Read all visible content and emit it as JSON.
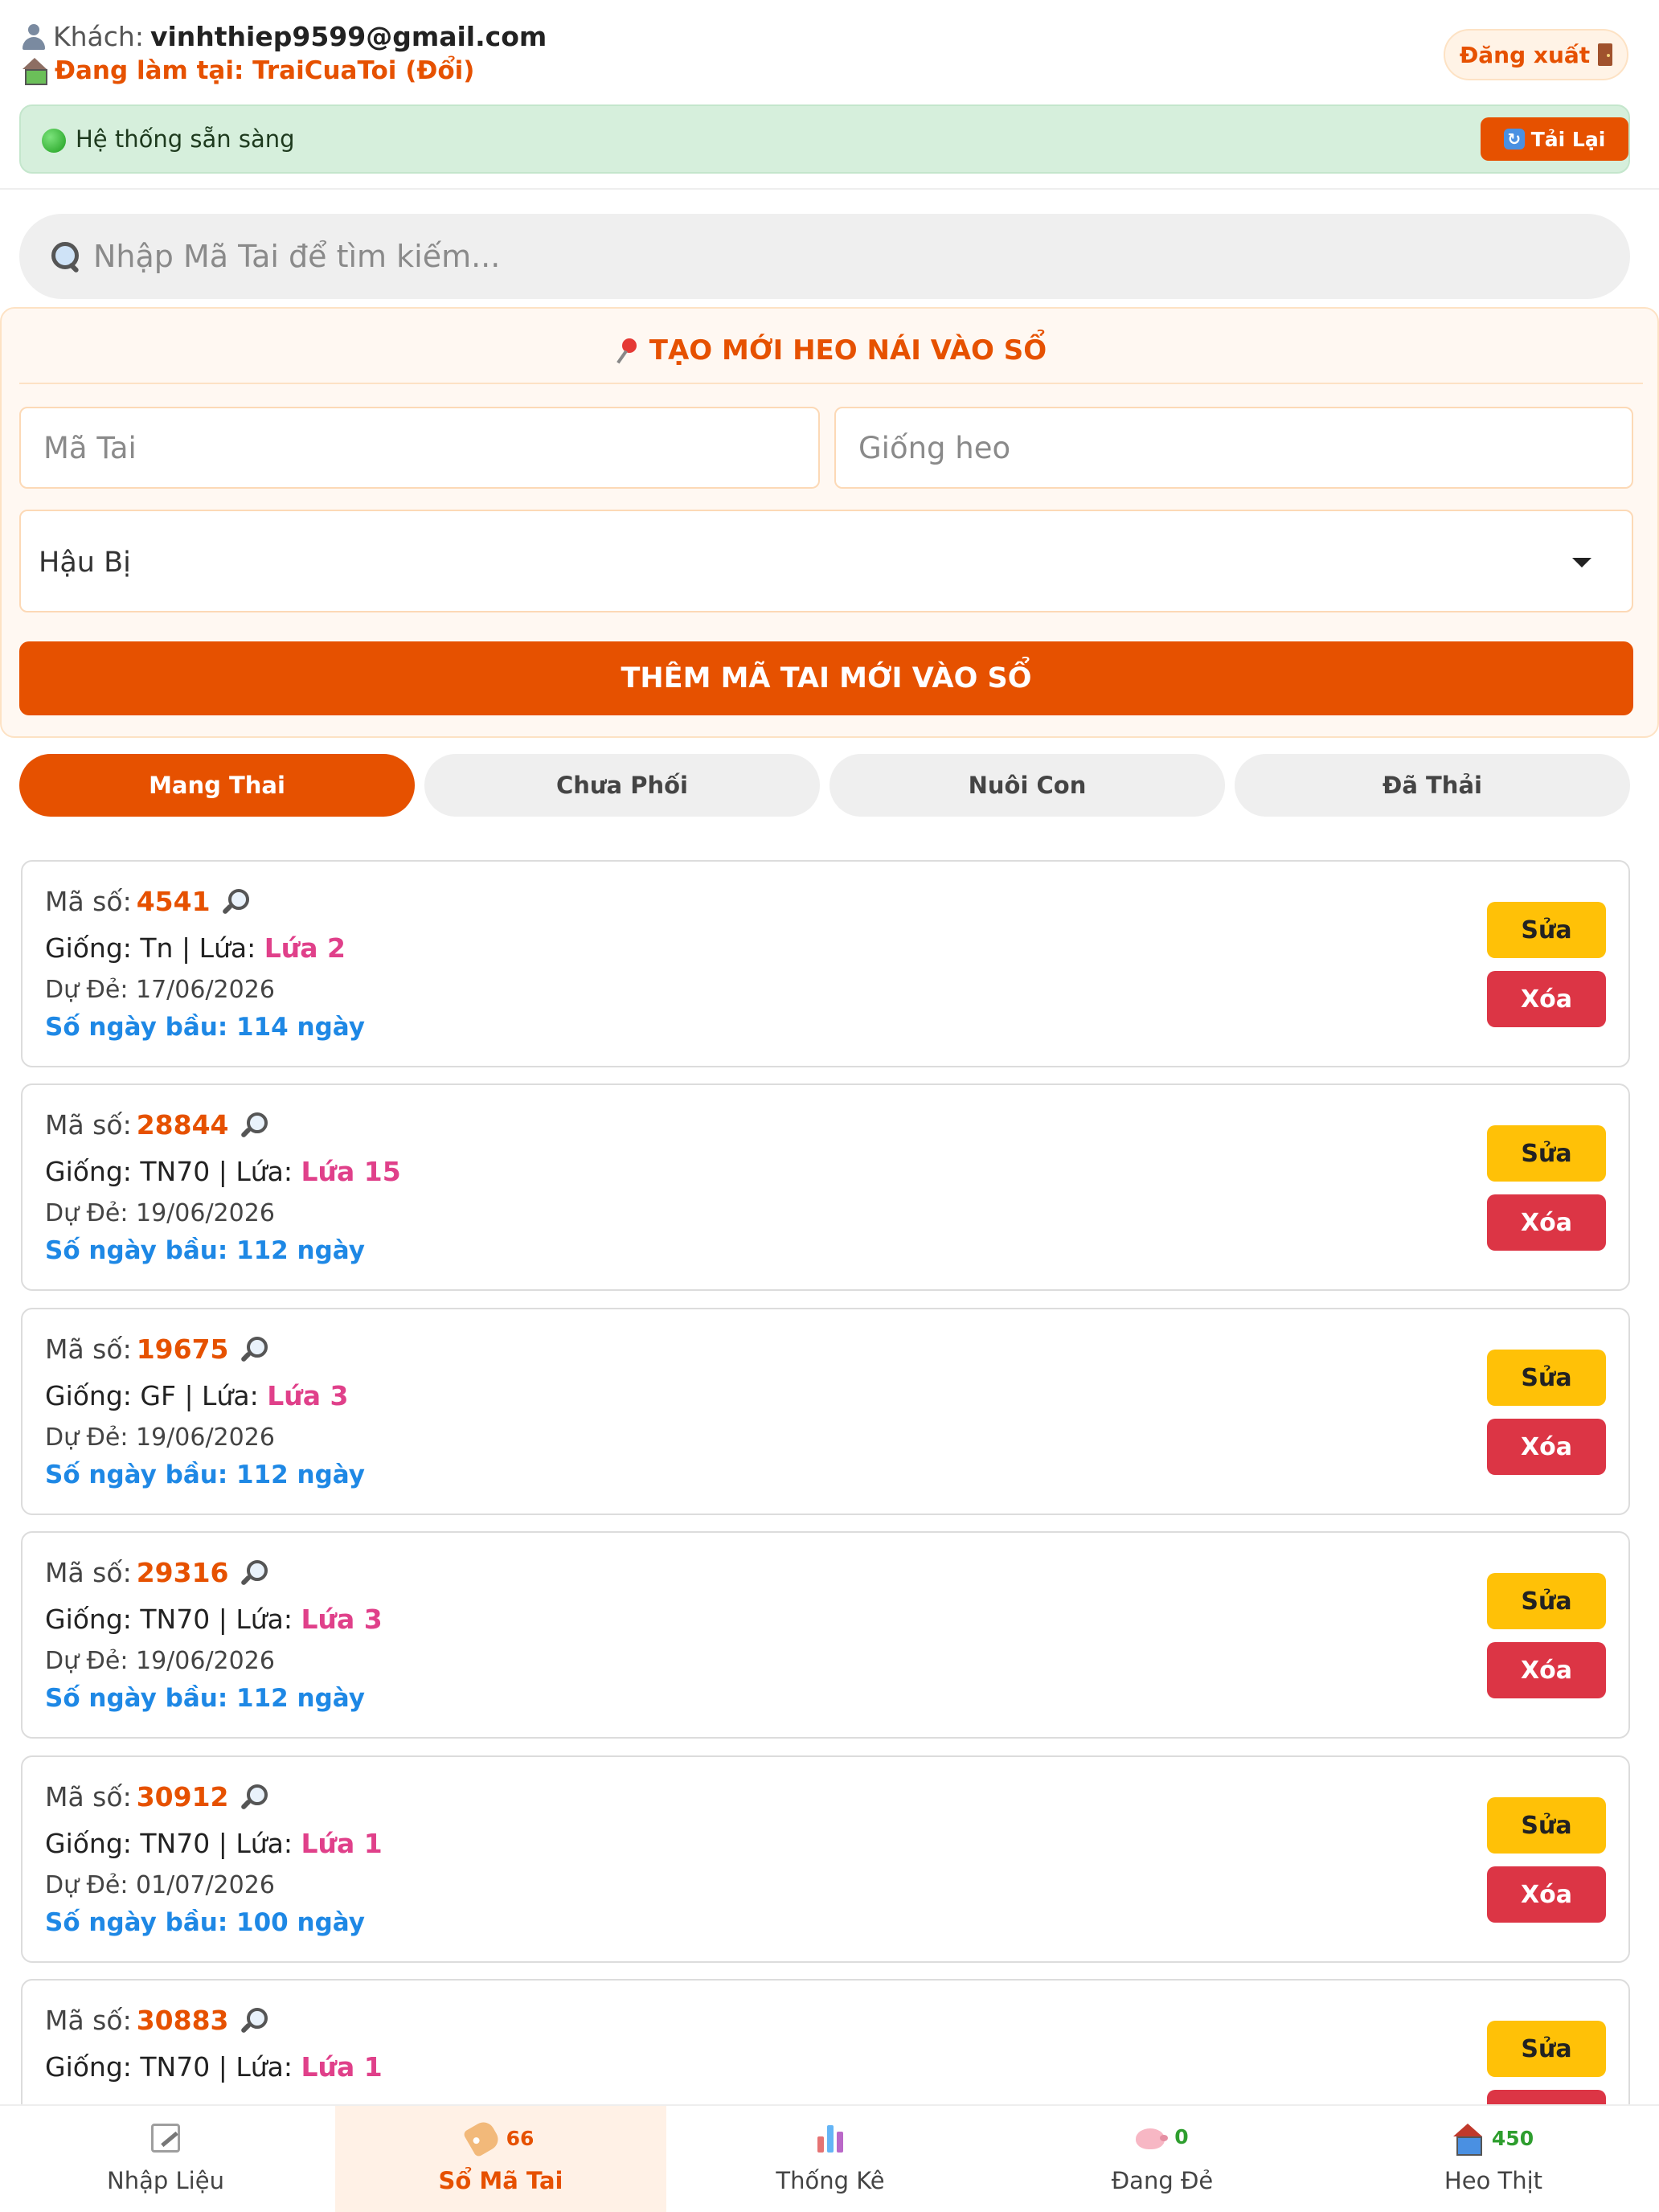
{
  "header": {
    "guest_label": "Khách:",
    "email": "vinhthiep9599@gmail.com",
    "farm_label": "Đang làm tại: TraiCuaToi (Đổi)",
    "logout_label": "Đăng xuất",
    "status_text": "Hệ thống sẵn sàng",
    "reload_label": "Tải Lại"
  },
  "search": {
    "placeholder": "Nhập Mã Tai để tìm kiếm..."
  },
  "create": {
    "title": "TẠO MỚI HEO NÁI VÀO SỔ",
    "tag_placeholder": "Mã Tai",
    "breed_placeholder": "Giống heo",
    "status_selected": "Hậu Bị",
    "add_button": "THÊM MÃ TAI MỚI VÀO SỔ"
  },
  "tabs": [
    {
      "label": "Mang Thai"
    },
    {
      "label": "Chưa Phối"
    },
    {
      "label": "Nuôi Con"
    },
    {
      "label": "Đã Thải"
    }
  ],
  "records": [
    {
      "id_label": "Mã số:",
      "id": "4541",
      "breed_prefix": "Giống: Tn | Lứa:",
      "parity": "Lứa 2",
      "due": "Dự Đẻ: 17/06/2026",
      "days": "Số ngày bầu: 114 ngày",
      "edit": "Sửa",
      "delete": "Xóa"
    },
    {
      "id_label": "Mã số:",
      "id": "28844",
      "breed_prefix": "Giống: TN70 | Lứa:",
      "parity": "Lứa 15",
      "due": "Dự Đẻ: 19/06/2026",
      "days": "Số ngày bầu: 112 ngày",
      "edit": "Sửa",
      "delete": "Xóa"
    },
    {
      "id_label": "Mã số:",
      "id": "19675",
      "breed_prefix": "Giống: GF | Lứa:",
      "parity": "Lứa 3",
      "due": "Dự Đẻ: 19/06/2026",
      "days": "Số ngày bầu: 112 ngày",
      "edit": "Sửa",
      "delete": "Xóa"
    },
    {
      "id_label": "Mã số:",
      "id": "29316",
      "breed_prefix": "Giống: TN70 | Lứa:",
      "parity": "Lứa 3",
      "due": "Dự Đẻ: 19/06/2026",
      "days": "Số ngày bầu: 112 ngày",
      "edit": "Sửa",
      "delete": "Xóa"
    },
    {
      "id_label": "Mã số:",
      "id": "30912",
      "breed_prefix": "Giống: TN70 | Lứa:",
      "parity": "Lứa 1",
      "due": "Dự Đẻ: 01/07/2026",
      "days": "Số ngày bầu: 100 ngày",
      "edit": "Sửa",
      "delete": "Xóa"
    },
    {
      "id_label": "Mã số:",
      "id": "30883",
      "breed_prefix": "Giống: TN70 | Lứa:",
      "parity": "Lứa 1",
      "due": "",
      "days": "",
      "edit": "Sửa",
      "delete": ""
    }
  ],
  "nav": [
    {
      "label": "Nhập Liệu",
      "badge": ""
    },
    {
      "label": "Sổ Mã Tai",
      "badge": "66"
    },
    {
      "label": "Thống Kê",
      "badge": ""
    },
    {
      "label": "Đang Đẻ",
      "badge": "0"
    },
    {
      "label": "Heo Thịt",
      "badge": "450"
    }
  ],
  "colors": {
    "accent": "#e65100",
    "status_bg": "#d6efdc",
    "edit": "#ffc107",
    "delete": "#dc3545",
    "parity": "#e0408a",
    "days": "#1e88e5"
  }
}
